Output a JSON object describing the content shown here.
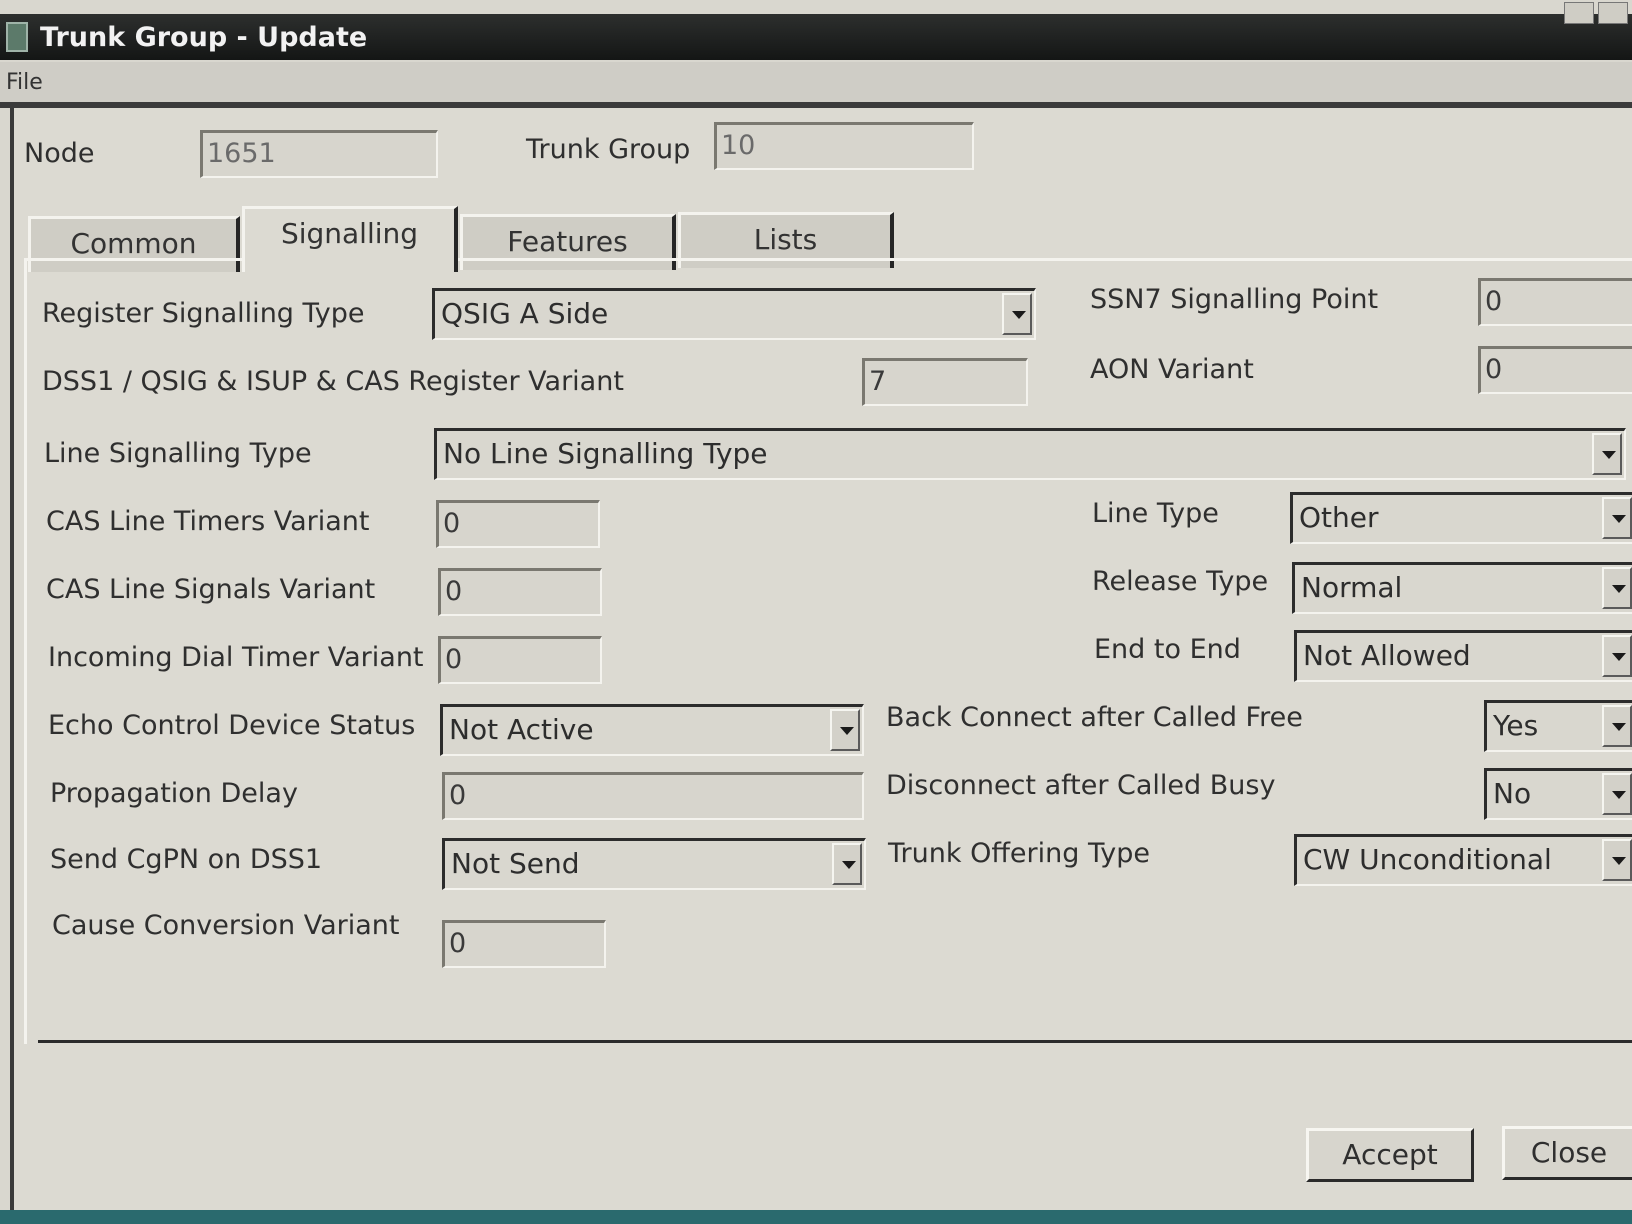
{
  "window": {
    "title": "Trunk Group - Update"
  },
  "menu": {
    "file": "File"
  },
  "header": {
    "node_label": "Node",
    "node_value": "1651",
    "trunk_group_label": "Trunk Group",
    "trunk_group_value": "10"
  },
  "tabs": [
    {
      "label": "Common",
      "active": false
    },
    {
      "label": "Signalling",
      "active": true
    },
    {
      "label": "Features",
      "active": false
    },
    {
      "label": "Lists",
      "active": false
    }
  ],
  "fields": {
    "register_signalling_type": {
      "label": "Register Signalling Type",
      "value": "QSIG A Side"
    },
    "register_variant": {
      "label": "DSS1 / QSIG & ISUP & CAS Register Variant",
      "value": "7"
    },
    "ssn7_signalling_point": {
      "label": "SSN7 Signalling Point",
      "value": "0"
    },
    "aon_variant": {
      "label": "AON Variant",
      "value": "0"
    },
    "line_signalling_type": {
      "label": "Line Signalling Type",
      "value": "No Line Signalling Type"
    },
    "cas_line_timers_variant": {
      "label": "CAS Line Timers Variant",
      "value": "0"
    },
    "cas_line_signals_variant": {
      "label": "CAS Line Signals Variant",
      "value": "0"
    },
    "incoming_dial_timer_variant": {
      "label": "Incoming Dial Timer Variant",
      "value": "0"
    },
    "echo_control_device_status": {
      "label": "Echo Control Device Status",
      "value": "Not Active"
    },
    "propagation_delay": {
      "label": "Propagation Delay",
      "value": "0"
    },
    "send_cgpn_on_dss1": {
      "label": "Send CgPN on DSS1",
      "value": "Not Send"
    },
    "cause_conversion_variant": {
      "label": "Cause Conversion Variant",
      "value": "0"
    },
    "line_type": {
      "label": "Line Type",
      "value": "Other"
    },
    "release_type": {
      "label": "Release Type",
      "value": "Normal"
    },
    "end_to_end": {
      "label": "End to End",
      "value": "Not Allowed"
    },
    "back_connect_after_called_free": {
      "label": "Back Connect after Called Free",
      "value": "Yes"
    },
    "disconnect_after_called_busy": {
      "label": "Disconnect after Called Busy",
      "value": "No"
    },
    "trunk_offering_type": {
      "label": "Trunk Offering Type",
      "value": "CW Unconditional"
    }
  },
  "buttons": {
    "accept": "Accept",
    "close": "Close"
  }
}
